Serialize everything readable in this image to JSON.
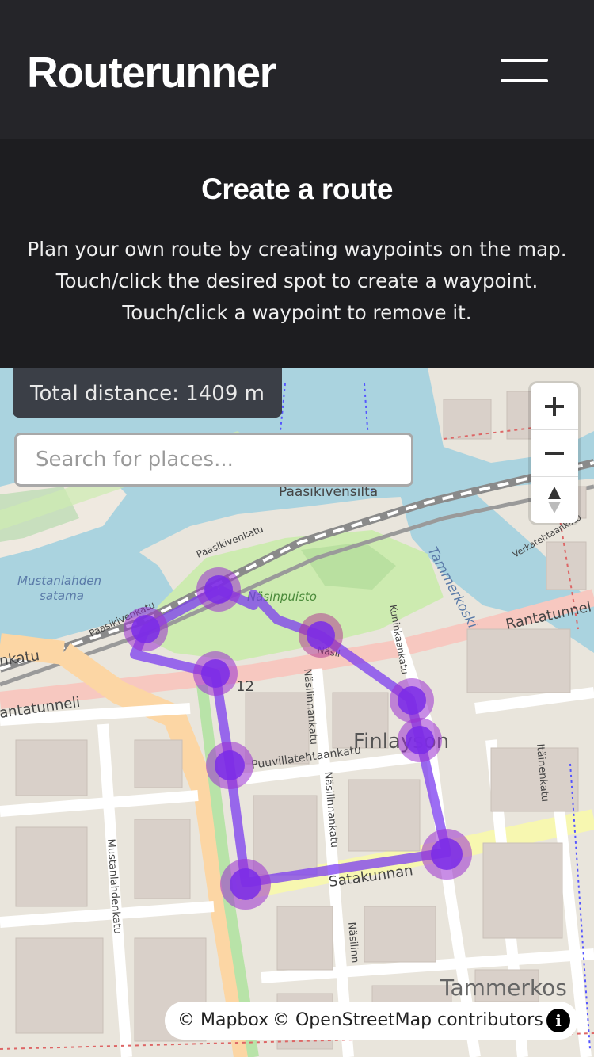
{
  "navbar": {
    "brand": "Routerunner",
    "menu_icon": "hamburger-menu-icon"
  },
  "intro": {
    "title": "Create a route",
    "lines": [
      "Plan your own route by creating waypoints on the map.",
      "Touch/click the desired spot to create a waypoint.",
      "Touch/click a waypoint to remove it."
    ]
  },
  "map": {
    "distance_label": "Total distance: 1409 m",
    "search_placeholder": "Search for places...",
    "zoom_in_icon": "plus-icon",
    "zoom_out_icon": "minus-icon",
    "compass_icon": "compass-icon",
    "attribution": {
      "mapbox": "© Mapbox",
      "osm": "© OpenStreetMap contributors",
      "info_icon": "info-icon"
    },
    "labels": {
      "paasikivensilta": "Paasikivensilta",
      "paasikivenkatu": "Paasikivenkatu",
      "paasikivenkatu2": "Paasikivenkatu",
      "mustanlahden_satama_1": "Mustanlahden",
      "mustanlahden_satama_2": "satama",
      "nasinpuisto": "Näsinpuisto",
      "tammerkoski": "Tammerkoski",
      "tammerkoski2": "Tammerkos",
      "rantatunneli": "Rantatunnel",
      "rantatunneli2": "antatunneli",
      "nkatu": "nkatu",
      "road_12": "12",
      "kuninkaankatu": "Kuninkaankatu",
      "nasilinnankatu": "Näsilinnankatu",
      "nasilinnankatu2": "Näsilinnankatu",
      "nasilinnankatu3": "Näsilinn",
      "nasilinnankatu4": "Näsil",
      "puuvillatehtaankatu": "Puuvillatehtaankatu",
      "finlayson": "Finlayson",
      "satakunnankatu": "Satakunnan",
      "itainenkatu": "Itäinenkatu",
      "mustanlahdenkatu": "Mustanlahdenkatu",
      "verkatehtaankatu": "Verkatehtaankatu"
    },
    "colors": {
      "route": "#7b3cf0",
      "waypoint": "#8a2be2",
      "water": "#aad3df",
      "park": "#c8facc"
    }
  }
}
